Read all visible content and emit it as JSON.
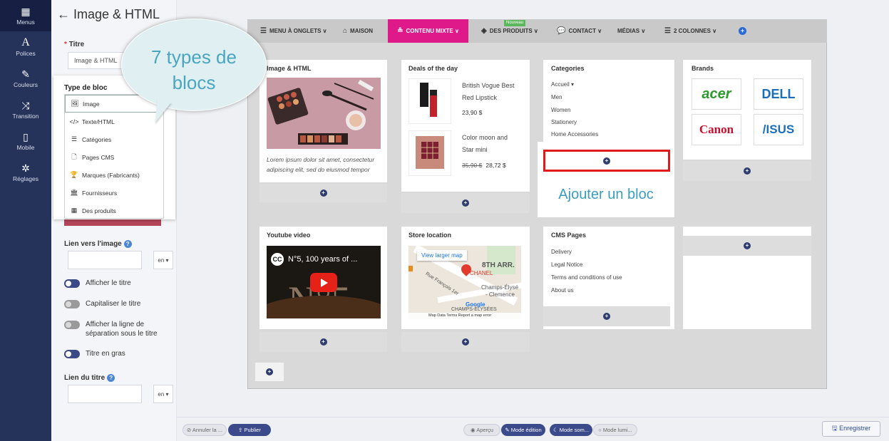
{
  "sidebar": {
    "items": [
      {
        "label": "Menus",
        "icon": "grid-icon"
      },
      {
        "label": "Polices",
        "icon": "font-icon"
      },
      {
        "label": "Couleurs",
        "icon": "brush-icon"
      },
      {
        "label": "Transition",
        "icon": "shuffle-icon"
      },
      {
        "label": "Mobile",
        "icon": "mobile-icon"
      },
      {
        "label": "Réglages",
        "icon": "gear-icon"
      }
    ]
  },
  "settings": {
    "header": "← Image & HTML",
    "title_label": "Titre",
    "title_value": "Image & HTML",
    "block_type_label": "Type de bloc",
    "link_image_label": "Lien vers l'image",
    "lang": "en ▾",
    "toggles": [
      {
        "label": "Afficher le titre",
        "state": "off"
      },
      {
        "label": "Capitaliser le titre",
        "state": "disabled"
      },
      {
        "label": "Afficher la ligne de séparation sous le titre",
        "state": "disabled"
      },
      {
        "label": "Titre en gras",
        "state": "off"
      }
    ],
    "title_link_label": "Lien du titre"
  },
  "dropdown": {
    "title": "Type de bloc",
    "items": [
      {
        "label": "Image",
        "icon": "🖼"
      },
      {
        "label": "Texte/HTML",
        "icon": "</>"
      },
      {
        "label": "Catégories",
        "icon": "☰"
      },
      {
        "label": "Pages CMS",
        "icon": "🗋"
      },
      {
        "label": "Marques (Fabricants)",
        "icon": "🏆"
      },
      {
        "label": "Fournisseurs",
        "icon": "🏛"
      },
      {
        "label": "Des produits",
        "icon": "▦"
      }
    ]
  },
  "bubble": {
    "line1": "7 types de",
    "line2": "blocs"
  },
  "nav": {
    "items": [
      {
        "label": "MENU À ONGLETS ∨",
        "icon": "☰"
      },
      {
        "label": "MAISON",
        "icon": "⌂"
      },
      {
        "label": "CONTENU MIXTE ∨",
        "icon": "≗"
      },
      {
        "label": "DES PRODUITS ∨",
        "icon": "◈"
      },
      {
        "label": "CONTACT ∨",
        "icon": "💬"
      },
      {
        "label": "MÉDIAS ∨",
        "icon": ""
      },
      {
        "label": "2 COLONNES ∨",
        "icon": "☰"
      }
    ],
    "new_badge": "Nouveau"
  },
  "blocks": {
    "image_html": {
      "title": "Image & HTML",
      "text_line1": "Lorem ipsum dolor sit amet, consectetur",
      "text_line2": "adipiscing elit, sed do eiusmod tempor"
    },
    "deals": {
      "title": "Deals of the day",
      "p1_line1": "British Vogue Best",
      "p1_line2": "Red Lipstick",
      "p1_price": "23,90 $",
      "p2_line1": "Color moon and",
      "p2_line2": "Star mini",
      "p2_old_price": "35,90 $",
      "p2_price": "28,72 $"
    },
    "categories": {
      "title": "Categories",
      "items": [
        "Accueil ▾",
        "Men",
        "Women",
        "Stationery",
        "Home Accessories"
      ]
    },
    "brands": {
      "title": "Brands",
      "items": [
        "acer",
        "DELL",
        "Canon",
        "/ISUS"
      ]
    },
    "youtube": {
      "title": "Youtube video",
      "video_title": "N°5, 100 years of ...",
      "logo_text": "N°5"
    },
    "store": {
      "title": "Store location",
      "view_map": "View larger map",
      "area": "8TH ARR.",
      "chanel": "CHANEL",
      "street": "Rue François 1er",
      "place1": "Champs-Élysé",
      "place2": "- Clemence",
      "place3": "CHAMPS-ÉLYSÉES",
      "google": "Google",
      "footer": "Map Data   Terms   Report a map error"
    },
    "cms": {
      "title": "CMS Pages",
      "items": [
        "Delivery",
        "Legal Notice",
        "Terms and conditions of use",
        "About us"
      ]
    }
  },
  "add_block_text": "Ajouter un bloc",
  "bottom": {
    "cancel": "⊘ Annuler la ...",
    "publish": "⇪ Publier",
    "preview": "◉ Aperçu",
    "edit_mode": "✎ Mode édition",
    "dark_mode": "☾ Mode som...",
    "light_mode": "○ Mode lumi...",
    "save": "🖫 Enregistrer"
  }
}
